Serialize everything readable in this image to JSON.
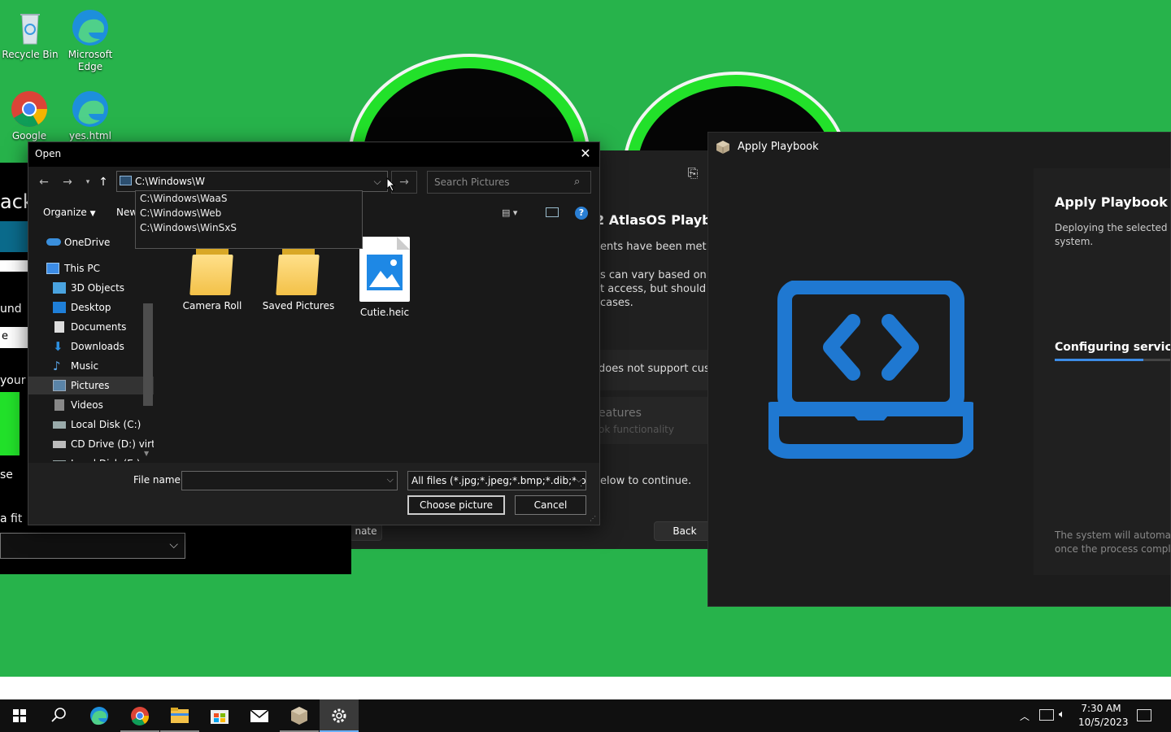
{
  "desktop": {
    "icons": [
      {
        "label": "Recycle Bin"
      },
      {
        "label": "Microsoft Edge"
      },
      {
        "label": "Google"
      },
      {
        "label": "yes.html"
      }
    ]
  },
  "bg_window_left": {
    "fragments": [
      "ack",
      "und",
      "e",
      "your p",
      "se",
      "a fit"
    ]
  },
  "atlas_window": {
    "heading": "2 AtlasOS Playbo",
    "line1": "ents have been met",
    "line2a": "s can vary based on yo",
    "line2b": "t access, but should no",
    "line2c": "cases.",
    "line3": "does not support cust",
    "line4": "eatures",
    "line4b": "ok functionality",
    "line5": "elow to continue.",
    "btn_left": "nate",
    "btn_back": "Back"
  },
  "playbook": {
    "title": "Apply Playbook",
    "heading": "Apply Playbook",
    "desc1": "Deploying the selected P",
    "desc2": "system.",
    "status": "Configuring services",
    "footer1": "The system will automatic",
    "footer2": "once the process comple"
  },
  "dialog": {
    "title": "Open",
    "address_value": "C:\\Windows\\W",
    "autocomplete": [
      "C:\\Windows\\WaaS",
      "C:\\Windows\\Web",
      "C:\\Windows\\WinSxS"
    ],
    "search_placeholder": "Search Pictures",
    "toolbar": {
      "organize": "Organize",
      "new_folder": "New"
    },
    "tree": [
      {
        "label": "OneDrive",
        "icon": "cloud-icon"
      },
      {
        "label": "This PC",
        "icon": "computer-icon"
      },
      {
        "label": "3D Objects",
        "icon": "cube-icon"
      },
      {
        "label": "Desktop",
        "icon": "desktop-icon"
      },
      {
        "label": "Documents",
        "icon": "document-icon"
      },
      {
        "label": "Downloads",
        "icon": "download-icon"
      },
      {
        "label": "Music",
        "icon": "music-icon"
      },
      {
        "label": "Pictures",
        "icon": "pictures-icon"
      },
      {
        "label": "Videos",
        "icon": "video-icon"
      },
      {
        "label": "Local Disk (C:)",
        "icon": "disk-icon"
      },
      {
        "label": "CD Drive (D:) virt",
        "icon": "cd-icon"
      },
      {
        "label": "Local Disk (E:)",
        "icon": "disk-icon"
      }
    ],
    "files": [
      {
        "label": "Camera Roll",
        "type": "folder"
      },
      {
        "label": "Saved Pictures",
        "type": "folder"
      },
      {
        "label": "Cutie.heic",
        "type": "image"
      }
    ],
    "file_name_label": "File name:",
    "file_name_value": "",
    "file_type": "All files (*.jpg;*.jpeg;*.bmp;*.dib;*.png",
    "choose_button": "Choose picture",
    "cancel_button": "Cancel"
  },
  "taskbar": {
    "time": "7:30 AM",
    "date": "10/5/2023"
  },
  "colors": {
    "desktop_bg": "#27b34b",
    "accent": "#3c8ce6",
    "playbook_icon": "#1f78d1"
  }
}
